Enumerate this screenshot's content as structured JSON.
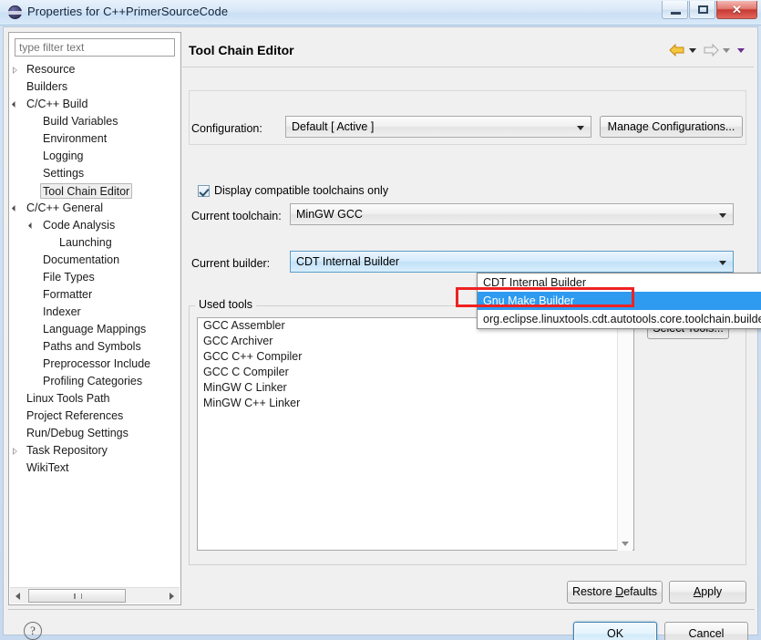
{
  "window": {
    "title": "Properties for C++PrimerSourceCode",
    "icon": "eclipse-icon",
    "controls": {
      "minimize": "minimize-icon",
      "maximize": "maximize-icon",
      "close": "✕"
    }
  },
  "sidebar": {
    "filter_placeholder": "type filter text",
    "items": [
      {
        "label": "Resource",
        "indent": 0,
        "twisty": "collapsed",
        "selected": false
      },
      {
        "label": "Builders",
        "indent": 0,
        "twisty": "none",
        "selected": false
      },
      {
        "label": "C/C++ Build",
        "indent": 0,
        "twisty": "expanded",
        "selected": false
      },
      {
        "label": "Build Variables",
        "indent": 1,
        "twisty": "none",
        "selected": false
      },
      {
        "label": "Environment",
        "indent": 1,
        "twisty": "none",
        "selected": false
      },
      {
        "label": "Logging",
        "indent": 1,
        "twisty": "none",
        "selected": false
      },
      {
        "label": "Settings",
        "indent": 1,
        "twisty": "none",
        "selected": false
      },
      {
        "label": "Tool Chain Editor",
        "indent": 1,
        "twisty": "none",
        "selected": true
      },
      {
        "label": "C/C++ General",
        "indent": 0,
        "twisty": "expanded",
        "selected": false
      },
      {
        "label": "Code Analysis",
        "indent": 1,
        "twisty": "expanded",
        "selected": false
      },
      {
        "label": "Launching",
        "indent": 2,
        "twisty": "none",
        "selected": false
      },
      {
        "label": "Documentation",
        "indent": 1,
        "twisty": "none",
        "selected": false
      },
      {
        "label": "File Types",
        "indent": 1,
        "twisty": "none",
        "selected": false
      },
      {
        "label": "Formatter",
        "indent": 1,
        "twisty": "none",
        "selected": false
      },
      {
        "label": "Indexer",
        "indent": 1,
        "twisty": "none",
        "selected": false
      },
      {
        "label": "Language Mappings",
        "indent": 1,
        "twisty": "none",
        "selected": false
      },
      {
        "label": "Paths and Symbols",
        "indent": 1,
        "twisty": "none",
        "selected": false
      },
      {
        "label": "Preprocessor Include",
        "indent": 1,
        "twisty": "none",
        "selected": false
      },
      {
        "label": "Profiling Categories",
        "indent": 1,
        "twisty": "none",
        "selected": false
      },
      {
        "label": "Linux Tools Path",
        "indent": 0,
        "twisty": "none",
        "selected": false
      },
      {
        "label": "Project References",
        "indent": 0,
        "twisty": "none",
        "selected": false
      },
      {
        "label": "Run/Debug Settings",
        "indent": 0,
        "twisty": "none",
        "selected": false
      },
      {
        "label": "Task Repository",
        "indent": 0,
        "twisty": "collapsed",
        "selected": false
      },
      {
        "label": "WikiText",
        "indent": 0,
        "twisty": "none",
        "selected": false
      }
    ]
  },
  "main": {
    "page_title": "Tool Chain Editor",
    "nav": {
      "back_icon": "arrow-left-icon",
      "back_caret": "▾",
      "forward_icon": "arrow-right-icon",
      "forward_caret": "▾",
      "menu_caret": "▾"
    },
    "configuration": {
      "label": "Configuration:",
      "value": "Default  [ Active ]",
      "manage_button": "Manage Configurations..."
    },
    "display_compatible": {
      "label": "Display compatible toolchains only",
      "checked": true
    },
    "current_toolchain": {
      "label": "Current toolchain:",
      "value": "MinGW GCC"
    },
    "current_builder": {
      "label": "Current builder:",
      "value": "CDT Internal Builder",
      "expanded": true,
      "options": [
        {
          "label": "CDT Internal Builder",
          "selected": false,
          "annotated": false
        },
        {
          "label": "Gnu Make Builder",
          "selected": true,
          "annotated": true
        },
        {
          "label": "org.eclipse.linuxtools.cdt.autotools.core.toolchain.builder",
          "selected": false,
          "annotated": false
        }
      ]
    },
    "used_tools": {
      "legend": "Used tools",
      "items": [
        "GCC Assembler",
        "GCC Archiver",
        "GCC C++ Compiler",
        "GCC C Compiler",
        "MinGW C Linker",
        "MinGW C++ Linker"
      ],
      "select_tools_button": "Select Tools..."
    },
    "restore_defaults_button": "Restore Defaults",
    "apply_button": "Apply"
  },
  "footer": {
    "help_icon": "?",
    "ok_button": "OK",
    "cancel_button": "Cancel"
  },
  "colors": {
    "highlight_blue": "#2e9bf0",
    "annotation_red": "#ee2222",
    "titlebar_blue": "#cadff4",
    "close_red": "#c63a32"
  }
}
